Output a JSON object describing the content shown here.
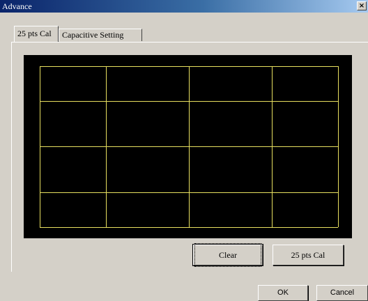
{
  "window": {
    "title": "Advance",
    "close_symbol": "×"
  },
  "tabs": [
    {
      "label": "25 pts Cal",
      "active": true
    },
    {
      "label": "Capacitive Setting",
      "active": false
    }
  ],
  "calibration_grid": {
    "columns": 4,
    "rows": 4,
    "line_color": "#e8e060",
    "background_color": "#000000"
  },
  "panel_buttons": {
    "clear": "Clear",
    "calibrate": "25 pts Cal"
  },
  "dialog_buttons": {
    "ok": "OK",
    "cancel": "Cancel"
  }
}
